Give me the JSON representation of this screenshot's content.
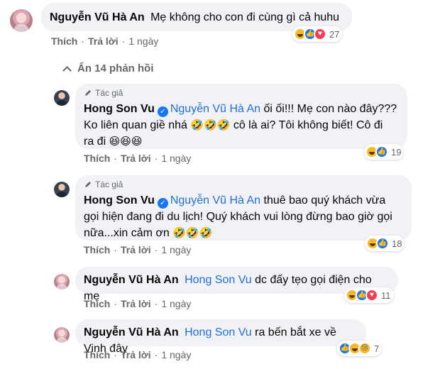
{
  "comments": [
    {
      "author": "Nguyễn Vũ Hà An",
      "text": "Mẹ không cho con đi cùng gì cả huhu",
      "like_label": "Thích",
      "reply_label": "Trả lời",
      "time": "1 ngày",
      "reaction_count": "27",
      "reactions": [
        "haha-icon",
        "like-icon",
        "love-icon"
      ]
    },
    {
      "badge": "Tác giả",
      "author": "Hong Son Vu",
      "mention": "Nguyễn Vũ Hà An",
      "text_line1": " ối ối!!! Mẹ con nào đây???",
      "text_line2a": "Ko liên quan giề nhá ",
      "emoji_a": "🤣🤣🤣",
      "text_line2b": " cô là ai? Tôi không biết! Cô đi",
      "text_line3": "ra đi ",
      "emoji_b": "😆😆😆",
      "like_label": "Thích",
      "reply_label": "Trả lời",
      "time": "1 ngày",
      "reaction_count": "19",
      "reactions": [
        "haha-icon",
        "like-icon"
      ]
    },
    {
      "badge": "Tác giả",
      "author": "Hong Son Vu",
      "mention": "Nguyễn Vũ Hà An",
      "text_line1": " thuê bao quý khách vừa",
      "text_line2": "gọi hiện đang đi du lịch! Quý khách vui lòng đừng bao giờ gọi",
      "text_line3": "nữa...xin cảm ơn ",
      "emoji": "🤣🤣🤣",
      "like_label": "Thích",
      "reply_label": "Trả lời",
      "time": "1 ngày",
      "reaction_count": "18",
      "reactions": [
        "haha-icon",
        "like-icon"
      ]
    },
    {
      "author": "Nguyễn Vũ Hà An",
      "mention": "Hong Son Vu",
      "text": " dc đấy tẹo gọi điện cho mẹ",
      "like_label": "Thích",
      "reply_label": "Trả lời",
      "time": "1 ngày",
      "reaction_count": "11",
      "reactions": [
        "haha-icon",
        "like-icon",
        "love-icon"
      ]
    },
    {
      "author": "Nguyễn Vũ Hà An",
      "mention": "Hong Son Vu",
      "text": " ra bến bắt xe về Vinh đây",
      "like_label": "Thích",
      "reply_label": "Trả lời",
      "time": "1 ngày",
      "reaction_count": "7",
      "reactions": [
        "like-icon",
        "haha-icon",
        "sad-icon"
      ]
    }
  ],
  "hide_replies_label": "Ẩn 14 phản hồi",
  "colors": {
    "link": "#216fdb",
    "bubble": "#f0f2f5",
    "meta": "#65676b",
    "like": "#1877f2",
    "love": "#f33e58",
    "haha": "#f7b928"
  }
}
